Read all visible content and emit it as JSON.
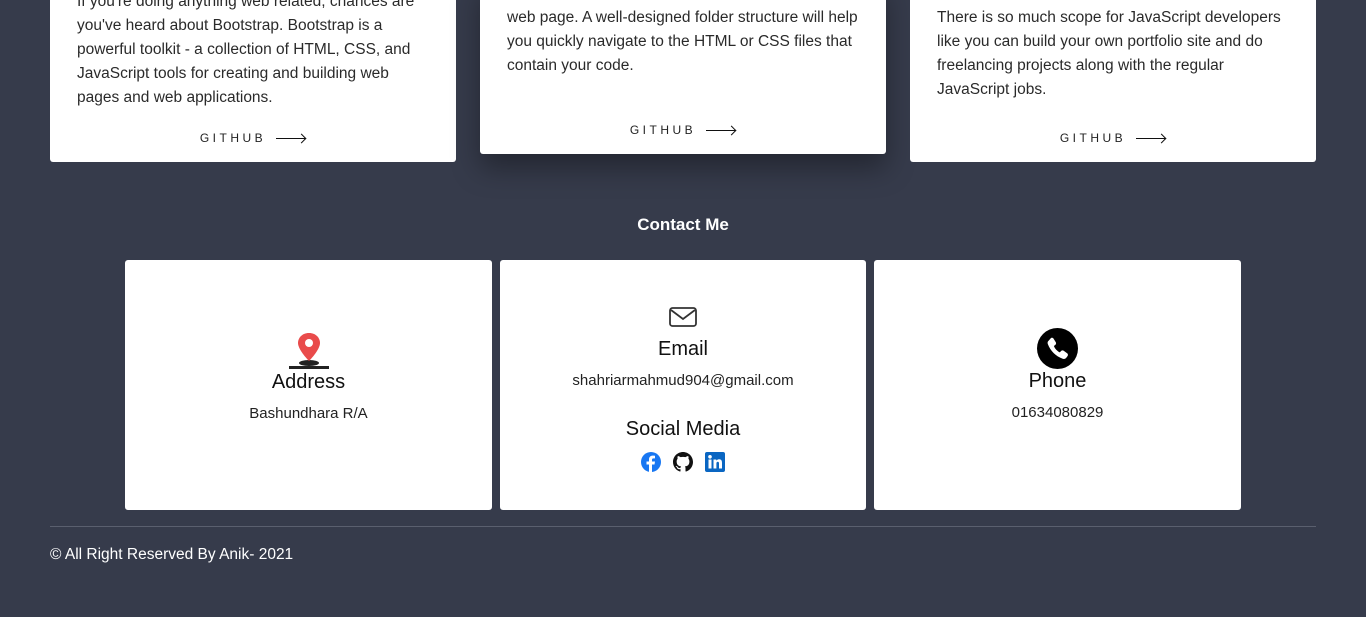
{
  "projects": [
    {
      "text": "If you're doing anything web related, chances are you've heard about Bootstrap. Bootstrap is a powerful toolkit - a collection of HTML, CSS, and JavaScript tools for creating and building web pages and web applications.",
      "link_label": "GITHUB"
    },
    {
      "text": "web page. A well-designed folder structure will help you quickly navigate to the HTML or CSS files that contain your code.",
      "link_label": "GITHUB"
    },
    {
      "text": "There is so much scope for JavaScript developers like you can build your own portfolio site and do freelancing projects along with the regular JavaScript jobs.",
      "link_label": "GITHUB"
    }
  ],
  "contact": {
    "title": "Contact Me",
    "address": {
      "icon": "map-pin-icon",
      "heading": "Address",
      "value": "Bashundhara R/A"
    },
    "email": {
      "icon": "envelope-icon",
      "heading": "Email",
      "value": "shahriarmahmud904@gmail.com"
    },
    "social": {
      "heading": "Social Media",
      "icons": [
        "facebook-icon",
        "github-icon",
        "linkedin-icon"
      ]
    },
    "phone": {
      "icon": "phone-icon",
      "heading": "Phone",
      "value": "01634080829"
    }
  },
  "footer": {
    "copyright": "© All Right Reserved By Anik- 2021"
  },
  "colors": {
    "background": "#363b4b",
    "card": "#ffffff",
    "pin": "#e94b4b",
    "facebook": "#1877f2",
    "linkedin": "#0a66c2"
  }
}
